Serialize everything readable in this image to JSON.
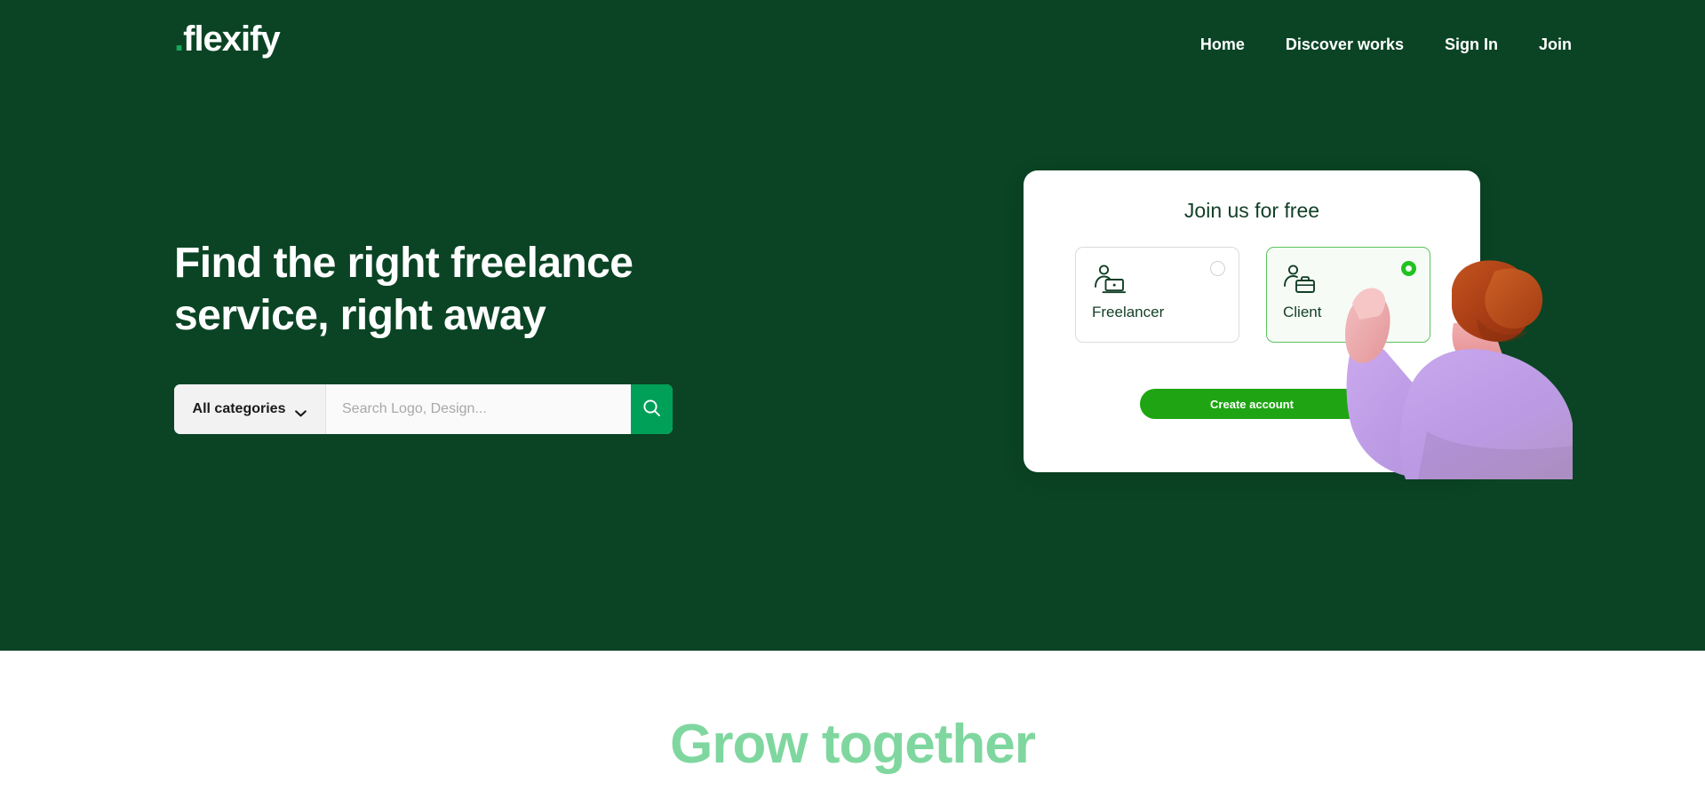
{
  "brand": {
    "logo_dot": ".",
    "logo_text": "flexify",
    "accent_green": "#17A75B",
    "hero_bg": "#0A4424",
    "button_green": "#00A059",
    "cta_green": "#1FA513",
    "grow_green": "#7FD79F"
  },
  "nav": {
    "items": [
      {
        "label": "Home"
      },
      {
        "label": "Discover works"
      },
      {
        "label": "Sign In"
      },
      {
        "label": "Join"
      }
    ]
  },
  "hero": {
    "headline_line1": "Find the right freelance",
    "headline_line2": "service, right away",
    "search": {
      "category_label": "All categories",
      "placeholder": "Search Logo, Design...",
      "value": "",
      "button_icon": "search-icon"
    }
  },
  "signup_card": {
    "title": "Join us for free",
    "roles": [
      {
        "label": "Freelancer",
        "icon": "person-laptop-icon",
        "selected": false
      },
      {
        "label": "Client",
        "icon": "person-briefcase-icon",
        "selected": true
      }
    ],
    "cta_label": "Create account"
  },
  "lower": {
    "section_title": "Grow together"
  }
}
